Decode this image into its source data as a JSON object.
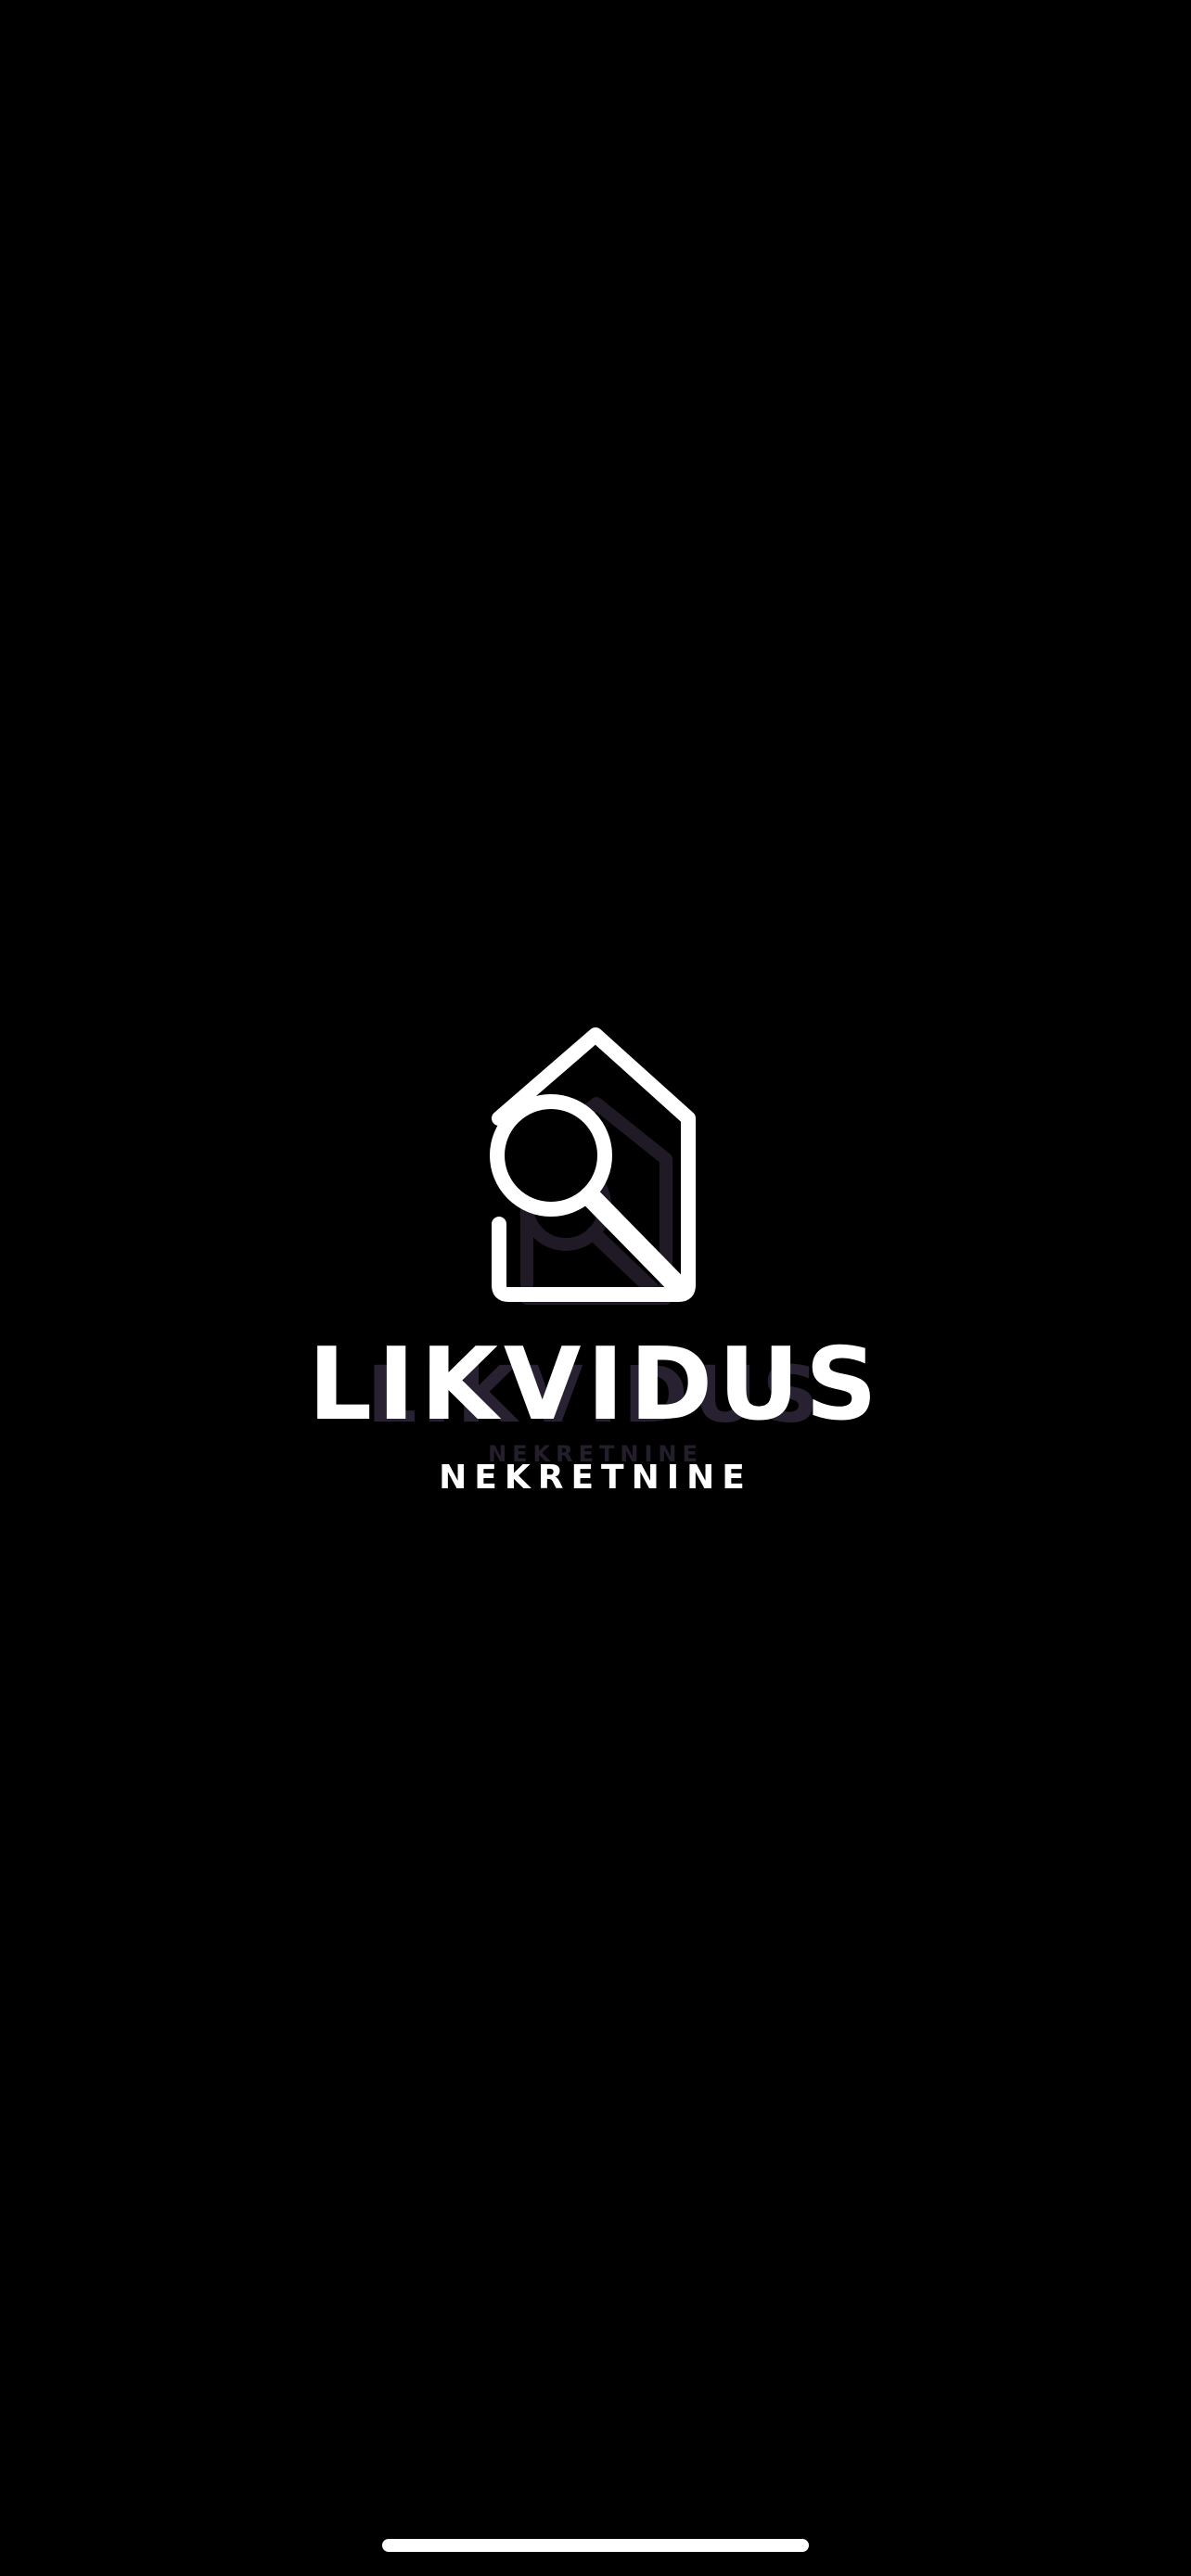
{
  "brand": {
    "name": "LIKVIDUS",
    "subtitle": "NEKRETNINE",
    "icon": "house-magnifier-icon"
  },
  "colors": {
    "background": "#000000",
    "foreground": "#ffffff",
    "ghost_accent": "#3a3046"
  }
}
